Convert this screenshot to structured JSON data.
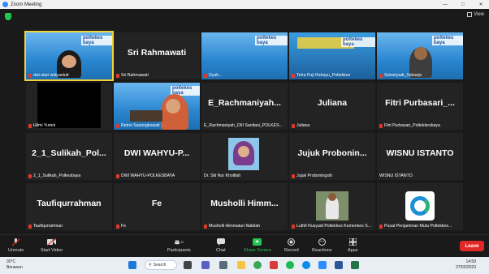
{
  "window": {
    "title": "Zoom Meeting"
  },
  "meeting": {
    "view_label": "View"
  },
  "tiles": [
    {
      "name": "dwi utari widyastuti",
      "big": ""
    },
    {
      "name": "Sri Rahmawati",
      "big": "Sri Rahmawati"
    },
    {
      "name": "Dyah...",
      "big": ""
    },
    {
      "name": "Tetra Puji Rahayu_Poltekkes",
      "big": ""
    },
    {
      "name": "Suhariyadi_Sidoarjo",
      "big": ""
    },
    {
      "name": "Hilmi Yumni",
      "big": ""
    },
    {
      "name": "Retno Sasongkowati",
      "big": ""
    },
    {
      "name": "E_Rachmaniyah_DIII Sanitasi_POLKES...",
      "big": "E_Rachmaniyah..."
    },
    {
      "name": "Juliana",
      "big": "Juliana"
    },
    {
      "name": "Fitri Purbasari_Poltekkesbaya",
      "big": "Fitri Purbasari_..."
    },
    {
      "name": "2_1_Sulikah_Polkesbaya",
      "big": "2_1_Sulikah_Pol..."
    },
    {
      "name": "DWI WAHYU-POLKESBAYA",
      "big": "DWI WAHYU-P..."
    },
    {
      "name": "Dr. Siti Nur Kholifah",
      "big": ""
    },
    {
      "name": "Jujuk Proboningsih",
      "big": "Jujuk Probonin..."
    },
    {
      "name": "WISNU ISTANTO",
      "big": "WISNU ISTANTO"
    },
    {
      "name": "Taufiqurrahman",
      "big": "Taufiqurrahman"
    },
    {
      "name": "Fe",
      "big": "Fe"
    },
    {
      "name": "Musholli Himmatun Nabilah",
      "big": "Musholli Himm..."
    },
    {
      "name": "Luthfi Rusyadi Poltekkes Kemenkes S...",
      "big": ""
    },
    {
      "name": "Pusat Penjaminan Mutu Poltekkes...",
      "big": ""
    }
  ],
  "banner": {
    "brand": "poltekes baya"
  },
  "toolbar": {
    "unmute": "Unmute",
    "start_video": "Start Video",
    "participants": "Participants",
    "participants_count": "20",
    "chat": "Chat",
    "share_screen": "Share Screen",
    "record": "Record",
    "reactions": "Reactions",
    "apps": "Apps",
    "leave": "Leave"
  },
  "taskbar": {
    "temp": "30°C",
    "weather": "Berawan",
    "search": "Search",
    "time": "14:59",
    "date": "27/03/2023"
  },
  "colors": {
    "accent": "#2d8cff",
    "leave": "#e02828",
    "share": "#23c552",
    "active_outline": "#f0d23c"
  }
}
